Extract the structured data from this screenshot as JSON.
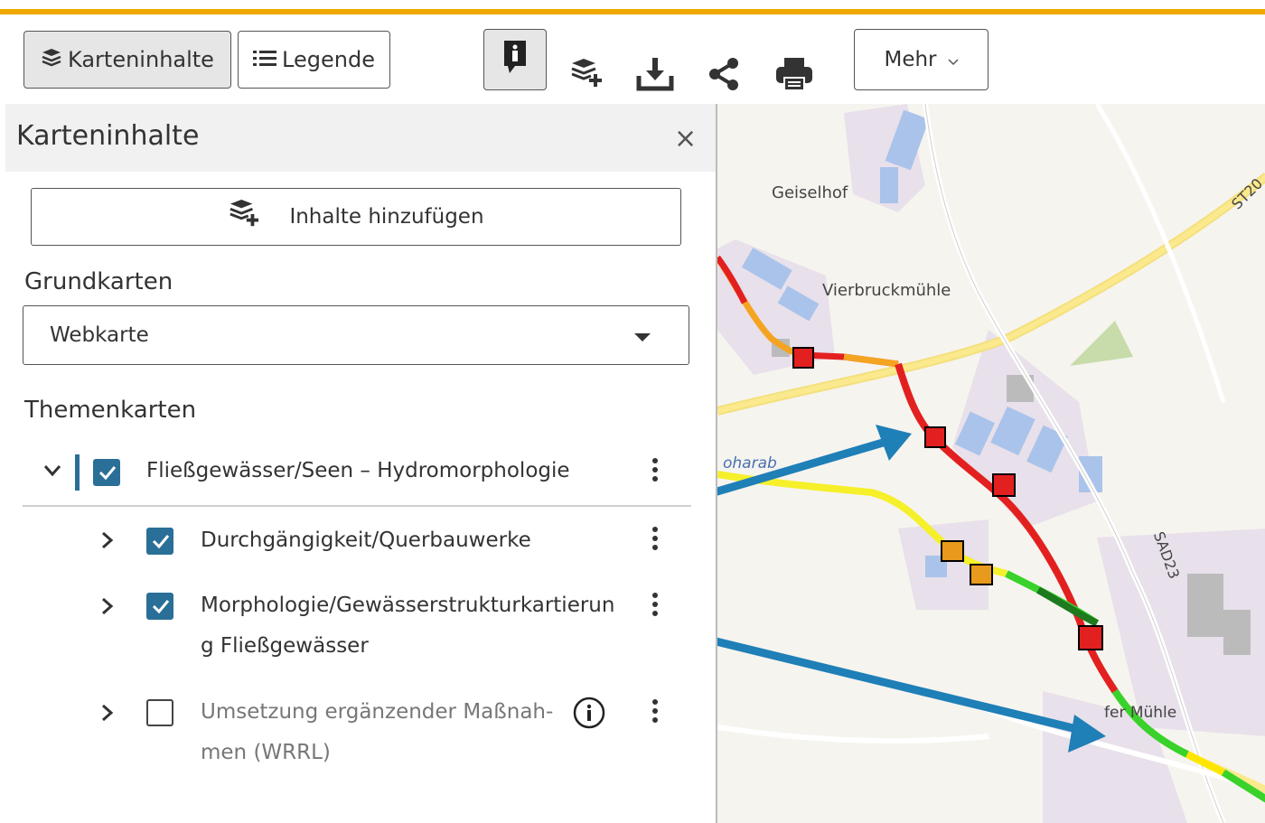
{
  "colors": {
    "accent": "#f0a800",
    "checkbox": "#2a6f98",
    "arrow": "#1f7fb7"
  },
  "toolbar": {
    "map_contents_label": "Karteninhalte",
    "legend_label": "Legende",
    "more_label": "Mehr",
    "icons": [
      "info-icon",
      "add-layers-icon",
      "download-icon",
      "share-icon",
      "print-icon"
    ]
  },
  "panel": {
    "title": "Karteninhalte",
    "close_glyph": "×",
    "add_content_label": "Inhalte hinzufügen",
    "basemaps_label": "Grundkarten",
    "basemap_selected": "Webkarte",
    "thematic_label": "Themenkarten",
    "layers": [
      {
        "label": "Fließgewässer/Seen – Hydromorphologie",
        "checked": true,
        "expanded": true
      },
      {
        "label": "Durchgängigkeit/Querbauwerke",
        "checked": true
      },
      {
        "label_line1": "Morphologie/Gewässerstrukturkartierun",
        "label_line2": "g Fließgewässer",
        "checked": true
      },
      {
        "label_line1": "Umsetzung ergänzender Maßnah-",
        "label_line2": "men (WRRL)",
        "checked": false
      }
    ]
  },
  "map": {
    "place_labels": [
      "Geiselhof",
      "Vierbruckmühle",
      "ST20",
      "SAD23",
      "oharab",
      "fer Mühle"
    ]
  }
}
